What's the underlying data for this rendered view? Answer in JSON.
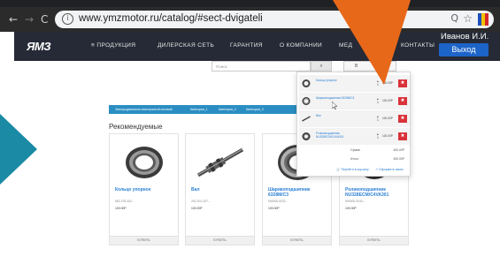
{
  "browser": {
    "url": "www.ymzmotor.ru/catalog/#sect-dvigateli",
    "back_glyph": "←",
    "forward_glyph": "→",
    "reload_glyph": "C",
    "info_glyph": "i",
    "zoom_glyph": "Q",
    "star_glyph": "☆",
    "extension_colors": [
      "#1f4fbf",
      "#f2c200",
      "#d62a2a"
    ]
  },
  "header": {
    "logo": "ЯМЗ",
    "menu": [
      "≡  ПРОДУКЦИЯ",
      "ДИЛЕРСКАЯ СЕТЬ",
      "ГАРАНТИЯ",
      "О КОМПАНИИ",
      "МЕД",
      "КОНТАКТЫ"
    ],
    "user_name": "Иванов И.И.",
    "logout_label": "Выход",
    "background": "#262a36",
    "accent": "#1d64c8"
  },
  "search": {
    "placeholder": "Поиск",
    "button_icon": "search-icon",
    "button_glyph": "⌕",
    "cart_label": "В"
  },
  "breadcrumbs": [
    "Электродвигатели асинхронный силовой",
    "Категория_1",
    "Категория_2",
    "Категория_3"
  ],
  "recommended_title": "Рекомендуемые",
  "products": [
    {
      "name": "Кольцо упорное",
      "code": "582.278.402...",
      "price": "100.00Р",
      "buy_label": "КУПИТЬ",
      "icon": "ring-icon"
    },
    {
      "name": "Вал",
      "code": "292.201.207...",
      "price": "100.00Р",
      "buy_label": "КУПИТЬ",
      "icon": "shaft-icon"
    },
    {
      "name": "Шарикоподшипник 6328M/C3",
      "code": "900000.0032...",
      "price": "100.00Р",
      "buy_label": "КУПИТЬ",
      "icon": "bearing-icon"
    },
    {
      "name": "Роликоподшипник NU328ECM/C4VA301",
      "code": "900000.0033...",
      "price": "100.00Р",
      "buy_label": "КУПИТЬ",
      "icon": "roller-bearing-icon"
    }
  ],
  "cart": {
    "items": [
      {
        "name": "Кольцо упорное",
        "qty": "1",
        "price": "100.00Р",
        "icon": "ring-icon"
      },
      {
        "name": "Шарикоподшипник 6328M/C3",
        "qty": "1",
        "price": "100.00Р",
        "icon": "bearing-icon"
      },
      {
        "name": "Вал",
        "qty": "1",
        "price": "100.00Р",
        "icon": "shaft-icon"
      },
      {
        "name": "Роликоподшипник NU328ECM/C4VA301",
        "qty": "1",
        "price": "100.00Р",
        "icon": "roller-bearing-icon"
      }
    ],
    "remove_glyph": "✖",
    "sum_label": "Сумма",
    "sum_value": "400.00Р",
    "total_label": "Итого",
    "total_value": "400.00Р",
    "goto_cart_label": "🛒 Перейти в корзину",
    "checkout_label": "↗ Оформить заказ"
  },
  "overlays": {
    "teal_color": "#1a8aa5",
    "orange_color": "#e8681a"
  }
}
